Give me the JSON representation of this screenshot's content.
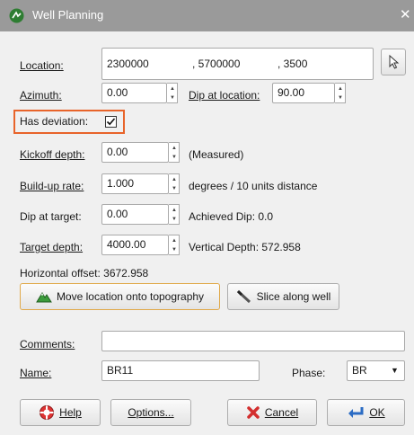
{
  "window": {
    "title": "Well Planning",
    "close_glyph": "✕"
  },
  "location": {
    "label": "Location:",
    "x": "2300000",
    "y": ", 5700000",
    "z": ", 3500",
    "pick_icon": "cursor-arrow-icon"
  },
  "azimuth": {
    "label": "Azimuth:",
    "value": "0.00"
  },
  "dip_at_location": {
    "label": "Dip at location:",
    "value": "90.00"
  },
  "has_deviation": {
    "label": "Has deviation:",
    "checked": true,
    "highlight_color": "#e8642a"
  },
  "kickoff_depth": {
    "label": "Kickoff depth:",
    "value": "0.00",
    "note": "(Measured)"
  },
  "build_up_rate": {
    "label": "Build-up rate:",
    "value": "1.000",
    "units": "degrees / 10 units distance"
  },
  "dip_at_target": {
    "label": "Dip at target:",
    "value": "0.00",
    "achieved_label": "Achieved Dip: 0.0"
  },
  "target_depth": {
    "label": "Target depth:",
    "value": "4000.00",
    "vertical_label": "Vertical Depth: 572.958"
  },
  "horizontal_offset": {
    "text": "Horizontal offset: 3672.958"
  },
  "actions": {
    "move_location": "Move location onto topography",
    "slice_along_well": "Slice along well"
  },
  "comments": {
    "label": "Comments:",
    "value": ""
  },
  "name": {
    "label": "Name:",
    "value": "BR11"
  },
  "phase": {
    "label": "Phase:",
    "value": "BR"
  },
  "footer": {
    "help": "Help",
    "options": "Options...",
    "cancel": "Cancel",
    "ok": "OK"
  },
  "colors": {
    "titlebar": "#9a9a9a",
    "accent": "#e8642a",
    "green_icon": "#3b9b3b"
  }
}
